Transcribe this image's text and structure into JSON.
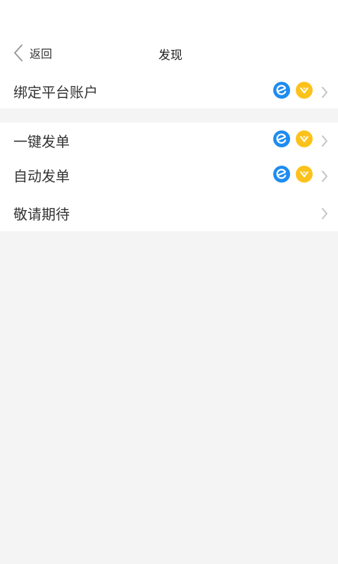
{
  "header": {
    "back_label": "返回",
    "title": "发现"
  },
  "sections": [
    {
      "rows": [
        {
          "label": "绑定平台账户",
          "icons": [
            "eleme-icon",
            "meituan-icon"
          ]
        }
      ]
    },
    {
      "rows": [
        {
          "label": "一键发单",
          "icons": [
            "eleme-icon",
            "meituan-icon"
          ]
        },
        {
          "label": "自动发单",
          "icons": [
            "eleme-icon",
            "meituan-icon"
          ]
        },
        {
          "label": "敬请期待",
          "icons": []
        }
      ]
    }
  ],
  "colors": {
    "background": "#f4f4f4",
    "surface": "#ffffff",
    "eleme_blue": "#1E8CF0",
    "meituan_yellow": "#FCC21B",
    "chevron_gray": "#c4c4c4",
    "text": "#333333"
  }
}
